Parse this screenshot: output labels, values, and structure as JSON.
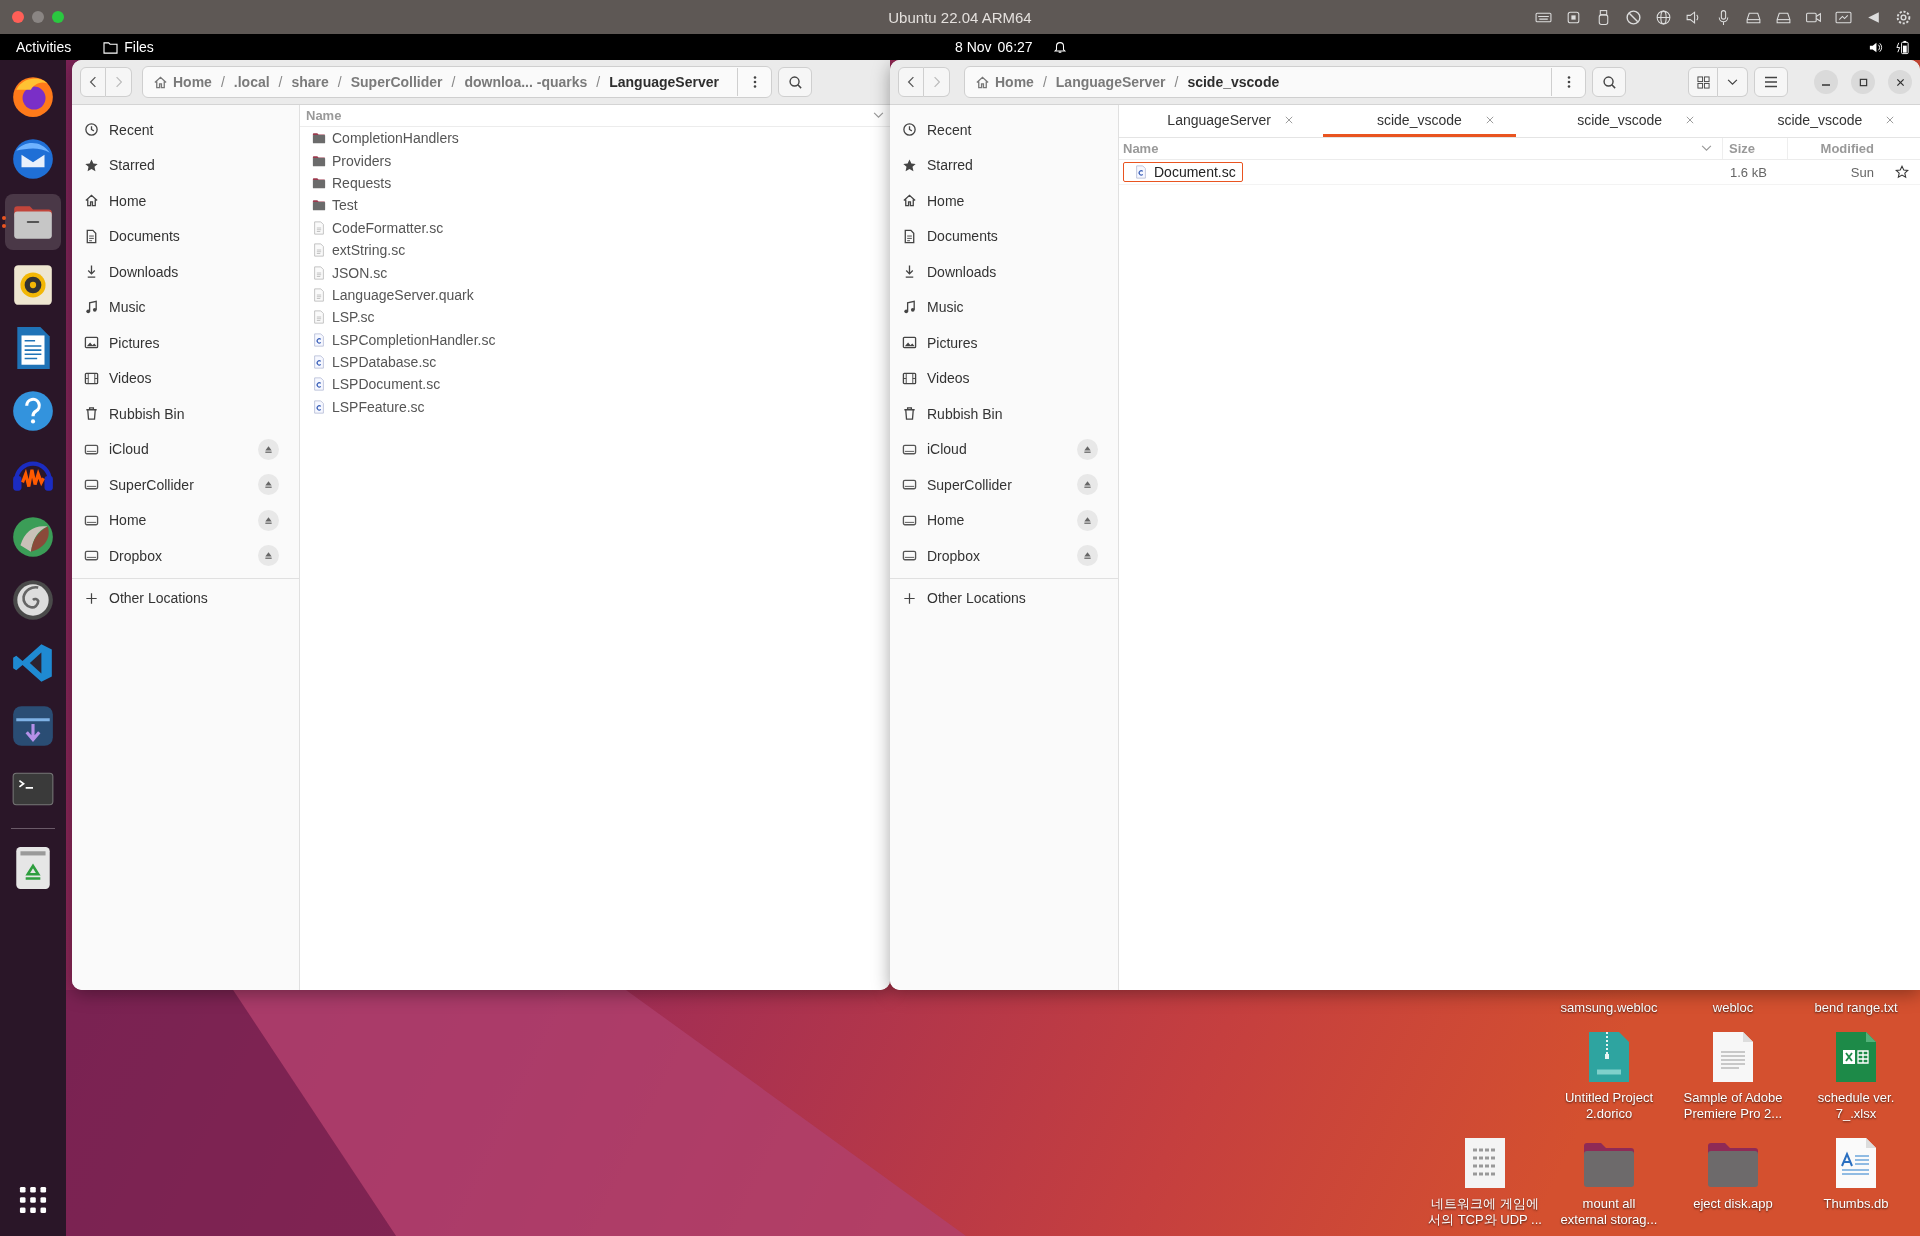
{
  "vm_window": {
    "title": "Ubuntu 22.04 ARM64"
  },
  "top_bar": {
    "activities": "Activities",
    "app": "Files",
    "date": "8 Nov",
    "time": "06:27"
  },
  "dock": [
    {
      "kind": "firefox",
      "active": false
    },
    {
      "kind": "mail",
      "active": false
    },
    {
      "kind": "files",
      "active": true
    },
    {
      "kind": "speaker",
      "active": false
    },
    {
      "kind": "writer",
      "active": false
    },
    {
      "kind": "help",
      "active": false
    },
    {
      "kind": "audio",
      "active": false
    },
    {
      "kind": "daw",
      "active": false
    },
    {
      "kind": "spiral",
      "active": false
    },
    {
      "kind": "code",
      "active": false
    },
    {
      "kind": "arrow",
      "active": false
    },
    {
      "kind": "terminal",
      "active": false
    },
    {
      "kind": "trash",
      "active": false
    }
  ],
  "left_window": {
    "path": {
      "separator": "/",
      "crumbs": [
        {
          "label": "Home",
          "kind": "home",
          "current": false
        },
        {
          "label": ".local",
          "kind": "dir",
          "current": false
        },
        {
          "label": "share",
          "kind": "dir",
          "current": false
        },
        {
          "label": "SuperCollider",
          "kind": "dir",
          "current": false
        },
        {
          "label": "downloa... -quarks",
          "kind": "dir",
          "current": false
        },
        {
          "label": "LanguageServer",
          "kind": "dir",
          "current": true
        }
      ]
    },
    "sidebar": [
      {
        "label": "Recent",
        "kind": "recent",
        "eject": false,
        "selected": false
      },
      {
        "label": "Starred",
        "kind": "starred",
        "eject": false,
        "selected": false
      },
      {
        "label": "Home",
        "kind": "home",
        "eject": false,
        "selected": false
      },
      {
        "label": "Documents",
        "kind": "documents",
        "eject": false,
        "selected": false
      },
      {
        "label": "Downloads",
        "kind": "downloads",
        "eject": false,
        "selected": false
      },
      {
        "label": "Music",
        "kind": "music",
        "eject": false,
        "selected": false
      },
      {
        "label": "Pictures",
        "kind": "pictures",
        "eject": false,
        "selected": false
      },
      {
        "label": "Videos",
        "kind": "videos",
        "eject": false,
        "selected": false
      },
      {
        "label": "Rubbish Bin",
        "kind": "trash",
        "eject": false,
        "selected": false
      },
      {
        "label": "iCloud",
        "kind": "drive",
        "eject": true,
        "selected": false
      },
      {
        "label": "SuperCollider",
        "kind": "drive",
        "eject": true,
        "selected": false
      },
      {
        "label": "Home",
        "kind": "drive",
        "eject": true,
        "selected": false
      },
      {
        "label": "Dropbox",
        "kind": "drive",
        "eject": true,
        "selected": false
      },
      {
        "label": "Other Locations",
        "kind": "other",
        "eject": false,
        "selected": false
      }
    ],
    "columns": [
      "Name"
    ],
    "files": [
      {
        "name": "CompletionHandlers",
        "kind": "folder",
        "selected": false
      },
      {
        "name": "Providers",
        "kind": "folder",
        "selected": false
      },
      {
        "name": "Requests",
        "kind": "folder",
        "selected": false
      },
      {
        "name": "Test",
        "kind": "folder",
        "selected": false
      },
      {
        "name": "CodeFormatter.sc",
        "kind": "text",
        "selected": false
      },
      {
        "name": "extString.sc",
        "kind": "text",
        "selected": false
      },
      {
        "name": "JSON.sc",
        "kind": "text",
        "selected": false
      },
      {
        "name": "LanguageServer.quark",
        "kind": "text",
        "selected": false
      },
      {
        "name": "LSP.sc",
        "kind": "text",
        "selected": false
      },
      {
        "name": "LSPCompletionHandler.sc",
        "kind": "source",
        "selected": false
      },
      {
        "name": "LSPDatabase.sc",
        "kind": "source",
        "selected": false
      },
      {
        "name": "LSPDocument.sc",
        "kind": "source",
        "selected": false
      },
      {
        "name": "LSPFeature.sc",
        "kind": "source",
        "selected": false
      }
    ]
  },
  "right_window": {
    "path": {
      "separator": "/",
      "crumbs": [
        {
          "label": "Home",
          "kind": "home",
          "current": false
        },
        {
          "label": "LanguageServer",
          "kind": "dir",
          "current": false
        },
        {
          "label": "scide_vscode",
          "kind": "dir",
          "current": true
        }
      ]
    },
    "tabs": [
      {
        "label": "LanguageServer",
        "selected": false
      },
      {
        "label": "scide_vscode",
        "selected": true
      },
      {
        "label": "scide_vscode",
        "selected": false
      },
      {
        "label": "scide_vscode",
        "selected": false
      }
    ],
    "sidebar": [
      {
        "label": "Recent",
        "kind": "recent",
        "eject": false,
        "selected": false
      },
      {
        "label": "Starred",
        "kind": "starred",
        "eject": false,
        "selected": false
      },
      {
        "label": "Home",
        "kind": "home",
        "eject": false,
        "selected": false
      },
      {
        "label": "Documents",
        "kind": "documents",
        "eject": false,
        "selected": false
      },
      {
        "label": "Downloads",
        "kind": "downloads",
        "eject": false,
        "selected": false
      },
      {
        "label": "Music",
        "kind": "music",
        "eject": false,
        "selected": false
      },
      {
        "label": "Pictures",
        "kind": "pictures",
        "eject": false,
        "selected": false
      },
      {
        "label": "Videos",
        "kind": "videos",
        "eject": false,
        "selected": false
      },
      {
        "label": "Rubbish Bin",
        "kind": "trash",
        "eject": false,
        "selected": false
      },
      {
        "label": "iCloud",
        "kind": "drive",
        "eject": true,
        "selected": false
      },
      {
        "label": "SuperCollider",
        "kind": "drive",
        "eject": true,
        "selected": false
      },
      {
        "label": "Home",
        "kind": "drive",
        "eject": true,
        "selected": false
      },
      {
        "label": "Dropbox",
        "kind": "drive",
        "eject": true,
        "selected": false
      },
      {
        "label": "Other Locations",
        "kind": "other",
        "eject": false,
        "selected": false
      }
    ],
    "columns": [
      "Name",
      "Size",
      "Modified"
    ],
    "files": [
      {
        "name": "Document.sc",
        "kind": "source",
        "size": "1.6 kB",
        "modified": "Sun",
        "selected": true,
        "starred": false
      }
    ]
  },
  "desktop_icons": [
    {
      "lines": [
        "samsung.webloc"
      ]
    },
    {
      "lines": [
        "webloc"
      ]
    },
    {
      "lines": [
        "bend range.txt"
      ]
    },
    {
      "lines": [
        "Untitled Project",
        "2.dorico"
      ],
      "kind": "zip"
    },
    {
      "lines": [
        "Sample of Adobe",
        "Premiere Pro 2..."
      ],
      "kind": "document"
    },
    {
      "lines": [
        "schedule ver.",
        "7_.xlsx"
      ],
      "kind": "spreadsheet"
    },
    {
      "lines": [
        "네트워크에 게임에",
        "서의 TCP와 UDP ..."
      ],
      "kind": "binary"
    },
    {
      "lines": [
        "mount all",
        "external storag..."
      ],
      "kind": "folder"
    },
    {
      "lines": [
        "eject disk.app"
      ],
      "kind": "folder"
    },
    {
      "lines": [
        "Thumbs.db"
      ],
      "kind": "textdoc"
    }
  ]
}
